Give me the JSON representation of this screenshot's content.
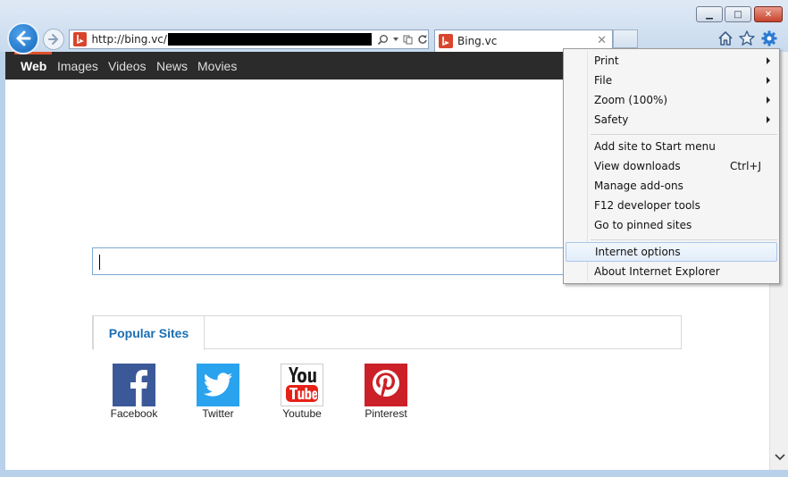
{
  "window": {
    "minimize_glyph": "▁",
    "maximize_glyph": "□",
    "close_glyph": "✕"
  },
  "address_bar": {
    "url_visible": "http://bing.vc/",
    "favicon_letter": "b"
  },
  "tab": {
    "title": "Bing.vc",
    "close_glyph": "✕"
  },
  "bing_nav": {
    "items": [
      "Web",
      "Images",
      "Videos",
      "News",
      "Movies"
    ]
  },
  "popular": {
    "tab_label": "Popular Sites",
    "sites": [
      {
        "name": "Facebook",
        "color": "#3b5998"
      },
      {
        "name": "Twitter",
        "color": "#2aa3ef"
      },
      {
        "name": "Youtube",
        "color": "#e62117"
      },
      {
        "name": "Pinterest",
        "color": "#cb2027"
      }
    ]
  },
  "menu": {
    "items": [
      {
        "label": "Print",
        "submenu": true
      },
      {
        "label": "File",
        "submenu": true
      },
      {
        "label": "Zoom (100%)",
        "submenu": true
      },
      {
        "label": "Safety",
        "submenu": true
      },
      {
        "label": "Add site to Start menu"
      },
      {
        "label": "View downloads",
        "shortcut": "Ctrl+J"
      },
      {
        "label": "Manage add-ons"
      },
      {
        "label": "F12 developer tools"
      },
      {
        "label": "Go to pinned sites"
      },
      {
        "label": "Internet options",
        "highlighted": true
      },
      {
        "label": "About Internet Explorer"
      }
    ]
  },
  "colors": {
    "accent_blue": "#1a6fb4",
    "bing_bar": "#2b2b2b",
    "bing_orange": "#e04f2c"
  },
  "icons": {
    "toolbar": [
      "home-icon",
      "favorites-star-icon",
      "tools-gear-icon"
    ],
    "address": [
      "search-icon",
      "dropdown-icon",
      "compatibility-icon",
      "refresh-icon"
    ]
  }
}
